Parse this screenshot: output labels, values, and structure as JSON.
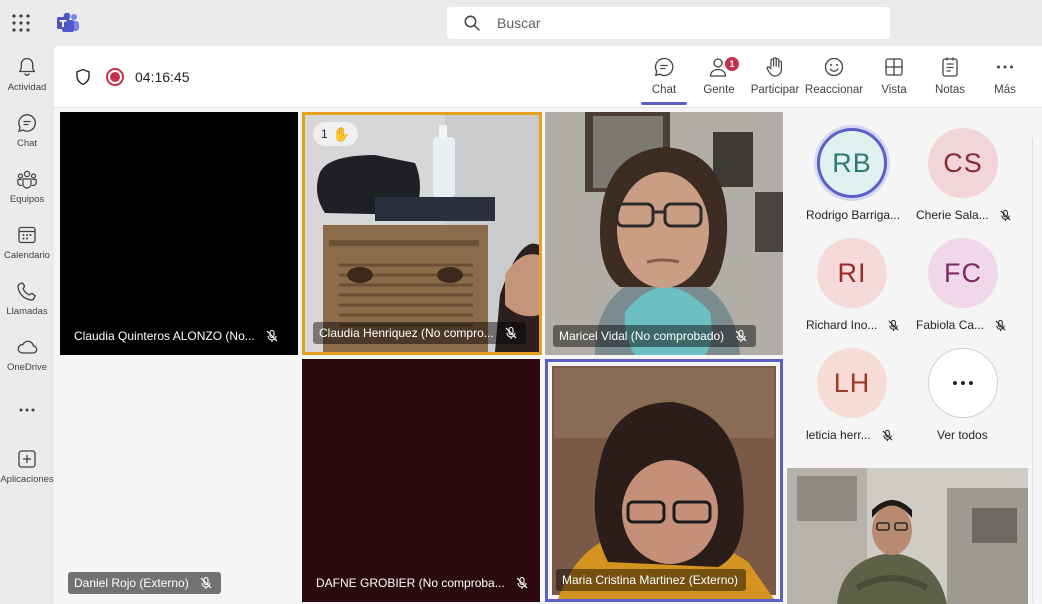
{
  "colors": {
    "accent": "#5b5fc7",
    "raised_hand_border": "#e8a020",
    "record": "#c4314b",
    "badge": "#c4314b"
  },
  "topbar": {
    "search_placeholder": "Buscar",
    "apps_icon": "apps-grid-icon",
    "logo_icon": "teams-logo-icon"
  },
  "rail": {
    "items": [
      {
        "label": "Actividad",
        "icon": "bell-icon"
      },
      {
        "label": "Chat",
        "icon": "chat-icon"
      },
      {
        "label": "Equipos",
        "icon": "teams-icon"
      },
      {
        "label": "Calendario",
        "icon": "calendar-icon"
      },
      {
        "label": "Llamadas",
        "icon": "phone-icon"
      },
      {
        "label": "OneDrive",
        "icon": "cloud-icon"
      },
      {
        "label": "Aplicaciones",
        "icon": "add-apps-icon"
      }
    ]
  },
  "meeting": {
    "timer": "04:16:45",
    "toolbar": {
      "chat": "Chat",
      "people": "Gente",
      "people_badge": "1",
      "raise": "Participar",
      "react": "Reaccionar",
      "view": "Vista",
      "notes": "Notas",
      "more": "Más"
    }
  },
  "tiles": [
    {
      "name": "Claudia Quinteros ALONZO (No...",
      "muted": true
    },
    {
      "name": "Claudia Henriquez (No compro...",
      "muted": true,
      "raised_hand_order": "1"
    },
    {
      "name": "Maricel Vidal (No comprobado)",
      "muted": true
    },
    {
      "name": "Daniel Rojo (Externo)",
      "muted": true
    },
    {
      "name": "DAFNE GROBIER (No comproba...",
      "muted": true
    },
    {
      "name": "Maria Cristina Martinez (Externo)",
      "muted": false
    }
  ],
  "roster": [
    {
      "initials": "RB",
      "name": "Rodrigo Barriga...",
      "muted": false,
      "speaking": true
    },
    {
      "initials": "CS",
      "name": "Cherie Sala...",
      "muted": true
    },
    {
      "initials": "RI",
      "name": "Richard Ino...",
      "muted": true
    },
    {
      "initials": "FC",
      "name": "Fabiola Ca...",
      "muted": true
    },
    {
      "initials": "LH",
      "name": "leticia herr...",
      "muted": true
    }
  ],
  "roster_more": {
    "label": "Ver todos",
    "icon": "more-dots-icon"
  }
}
